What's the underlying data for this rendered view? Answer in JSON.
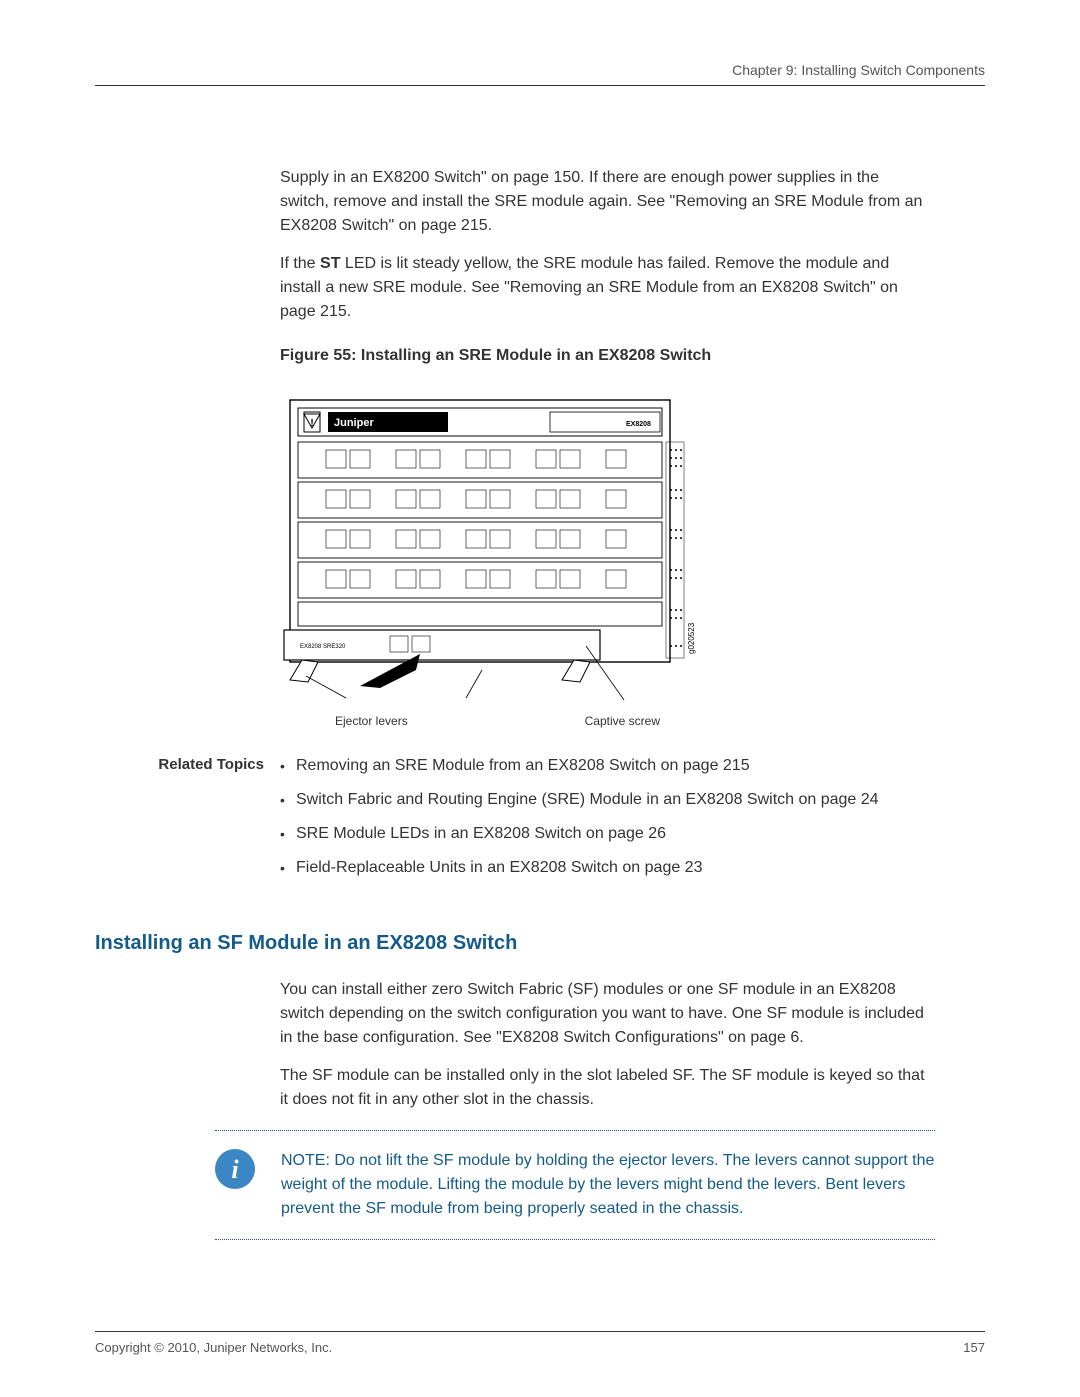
{
  "header": {
    "chapter": "Chapter 9: Installing Switch Components"
  },
  "body": {
    "para1": "Supply in an EX8200 Switch\" on page 150. If there are enough power supplies in the switch, remove and install the SRE module again. See \"Removing an SRE Module from an EX8208 Switch\" on page 215.",
    "para2_pre": "If the ",
    "para2_st": "ST",
    "para2_post": " LED is lit steady yellow, the SRE module has failed. Remove the module and install a new SRE module. See \"Removing an SRE Module from an EX8208 Switch\" on page 215.",
    "figure_caption": "Figure 55: Installing an SRE Module in an EX8208 Switch",
    "figure_label_left": "Ejector levers",
    "figure_label_right": "Captive screw",
    "figure_side_code": "g020523",
    "figure_brand": "Juniper",
    "figure_model": "EX8208"
  },
  "related": {
    "title": "Related Topics",
    "items": [
      "Removing an SRE Module from an EX8208 Switch on page 215",
      "Switch Fabric and Routing Engine (SRE) Module in an EX8208 Switch on page 24",
      "SRE Module LEDs in an EX8208 Switch on page 26",
      "Field-Replaceable Units in an EX8208 Switch on page 23"
    ]
  },
  "section": {
    "heading": "Installing an SF Module in an EX8208 Switch",
    "para1": "You can install either zero Switch Fabric (SF) modules or one SF module in an EX8208 switch depending on the switch configuration you want to have. One SF module is included in the base configuration. See \"EX8208 Switch Configurations\" on page 6.",
    "para2": "The SF module can be installed only in the slot labeled SF. The SF module is keyed so that it does not fit in any other slot in the chassis."
  },
  "note": {
    "text": "NOTE:  Do not lift the SF module by holding the ejector levers. The levers cannot support the weight of the module. Lifting the module by the levers might bend the levers. Bent levers prevent the SF module from being properly seated in the chassis."
  },
  "footer": {
    "copyright": "Copyright © 2010, Juniper Networks, Inc.",
    "page": "157"
  }
}
